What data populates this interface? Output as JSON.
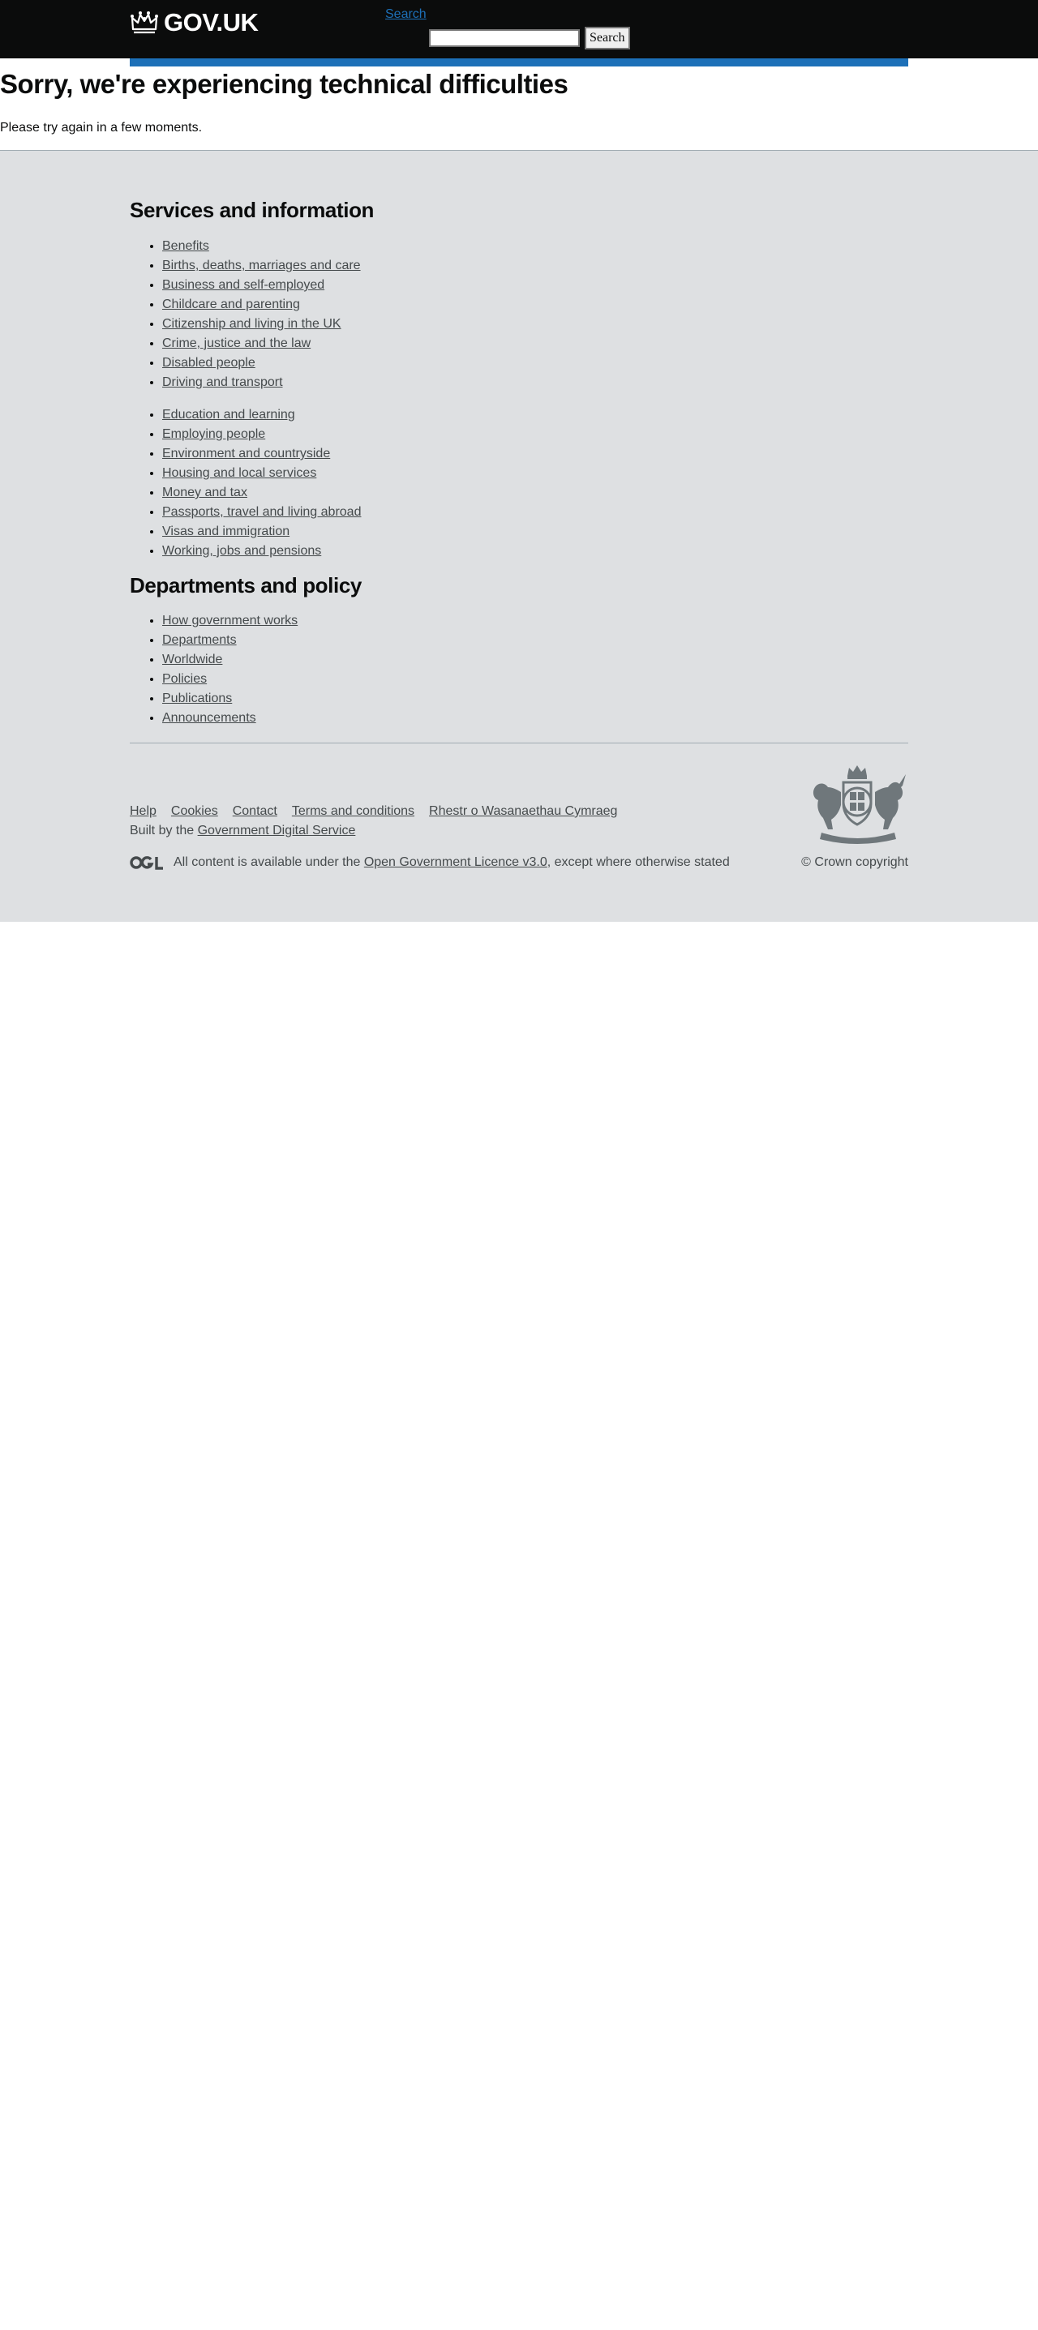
{
  "header": {
    "logo_text": "GOV.UK",
    "search_toggle": "Search",
    "search_input_value": "",
    "search_button": "Search"
  },
  "error": {
    "title": "Sorry, we're experiencing technical difficulties",
    "message": "Please try again in a few moments."
  },
  "footer": {
    "services_heading": "Services and information",
    "services_col1": [
      "Benefits",
      "Births, deaths, marriages and care",
      "Business and self-employed",
      "Childcare and parenting",
      "Citizenship and living in the UK",
      "Crime, justice and the law",
      "Disabled people",
      "Driving and transport"
    ],
    "services_col2": [
      "Education and learning",
      "Employing people",
      "Environment and countryside",
      "Housing and local services",
      "Money and tax",
      "Passports, travel and living abroad",
      "Visas and immigration",
      "Working, jobs and pensions"
    ],
    "departments_heading": "Departments and policy",
    "departments": [
      "How government works",
      "Departments",
      "Worldwide",
      "Policies",
      "Publications",
      "Announcements"
    ],
    "meta_links": [
      "Help",
      "Cookies",
      "Contact",
      "Terms and conditions",
      "Rhestr o Wasanaethau Cymraeg"
    ],
    "built_by_prefix": "Built by the ",
    "built_by_link": "Government Digital Service",
    "licence_prefix": "All content is available under the ",
    "licence_link": "Open Government Licence v3.0",
    "licence_suffix": ", except where otherwise stated",
    "copyright": "© Crown copyright"
  },
  "colors": {
    "header_bg": "#0b0c0c",
    "accent_blue": "#1d70b8",
    "footer_bg": "#dee0e2",
    "footer_text": "#454a4c"
  }
}
